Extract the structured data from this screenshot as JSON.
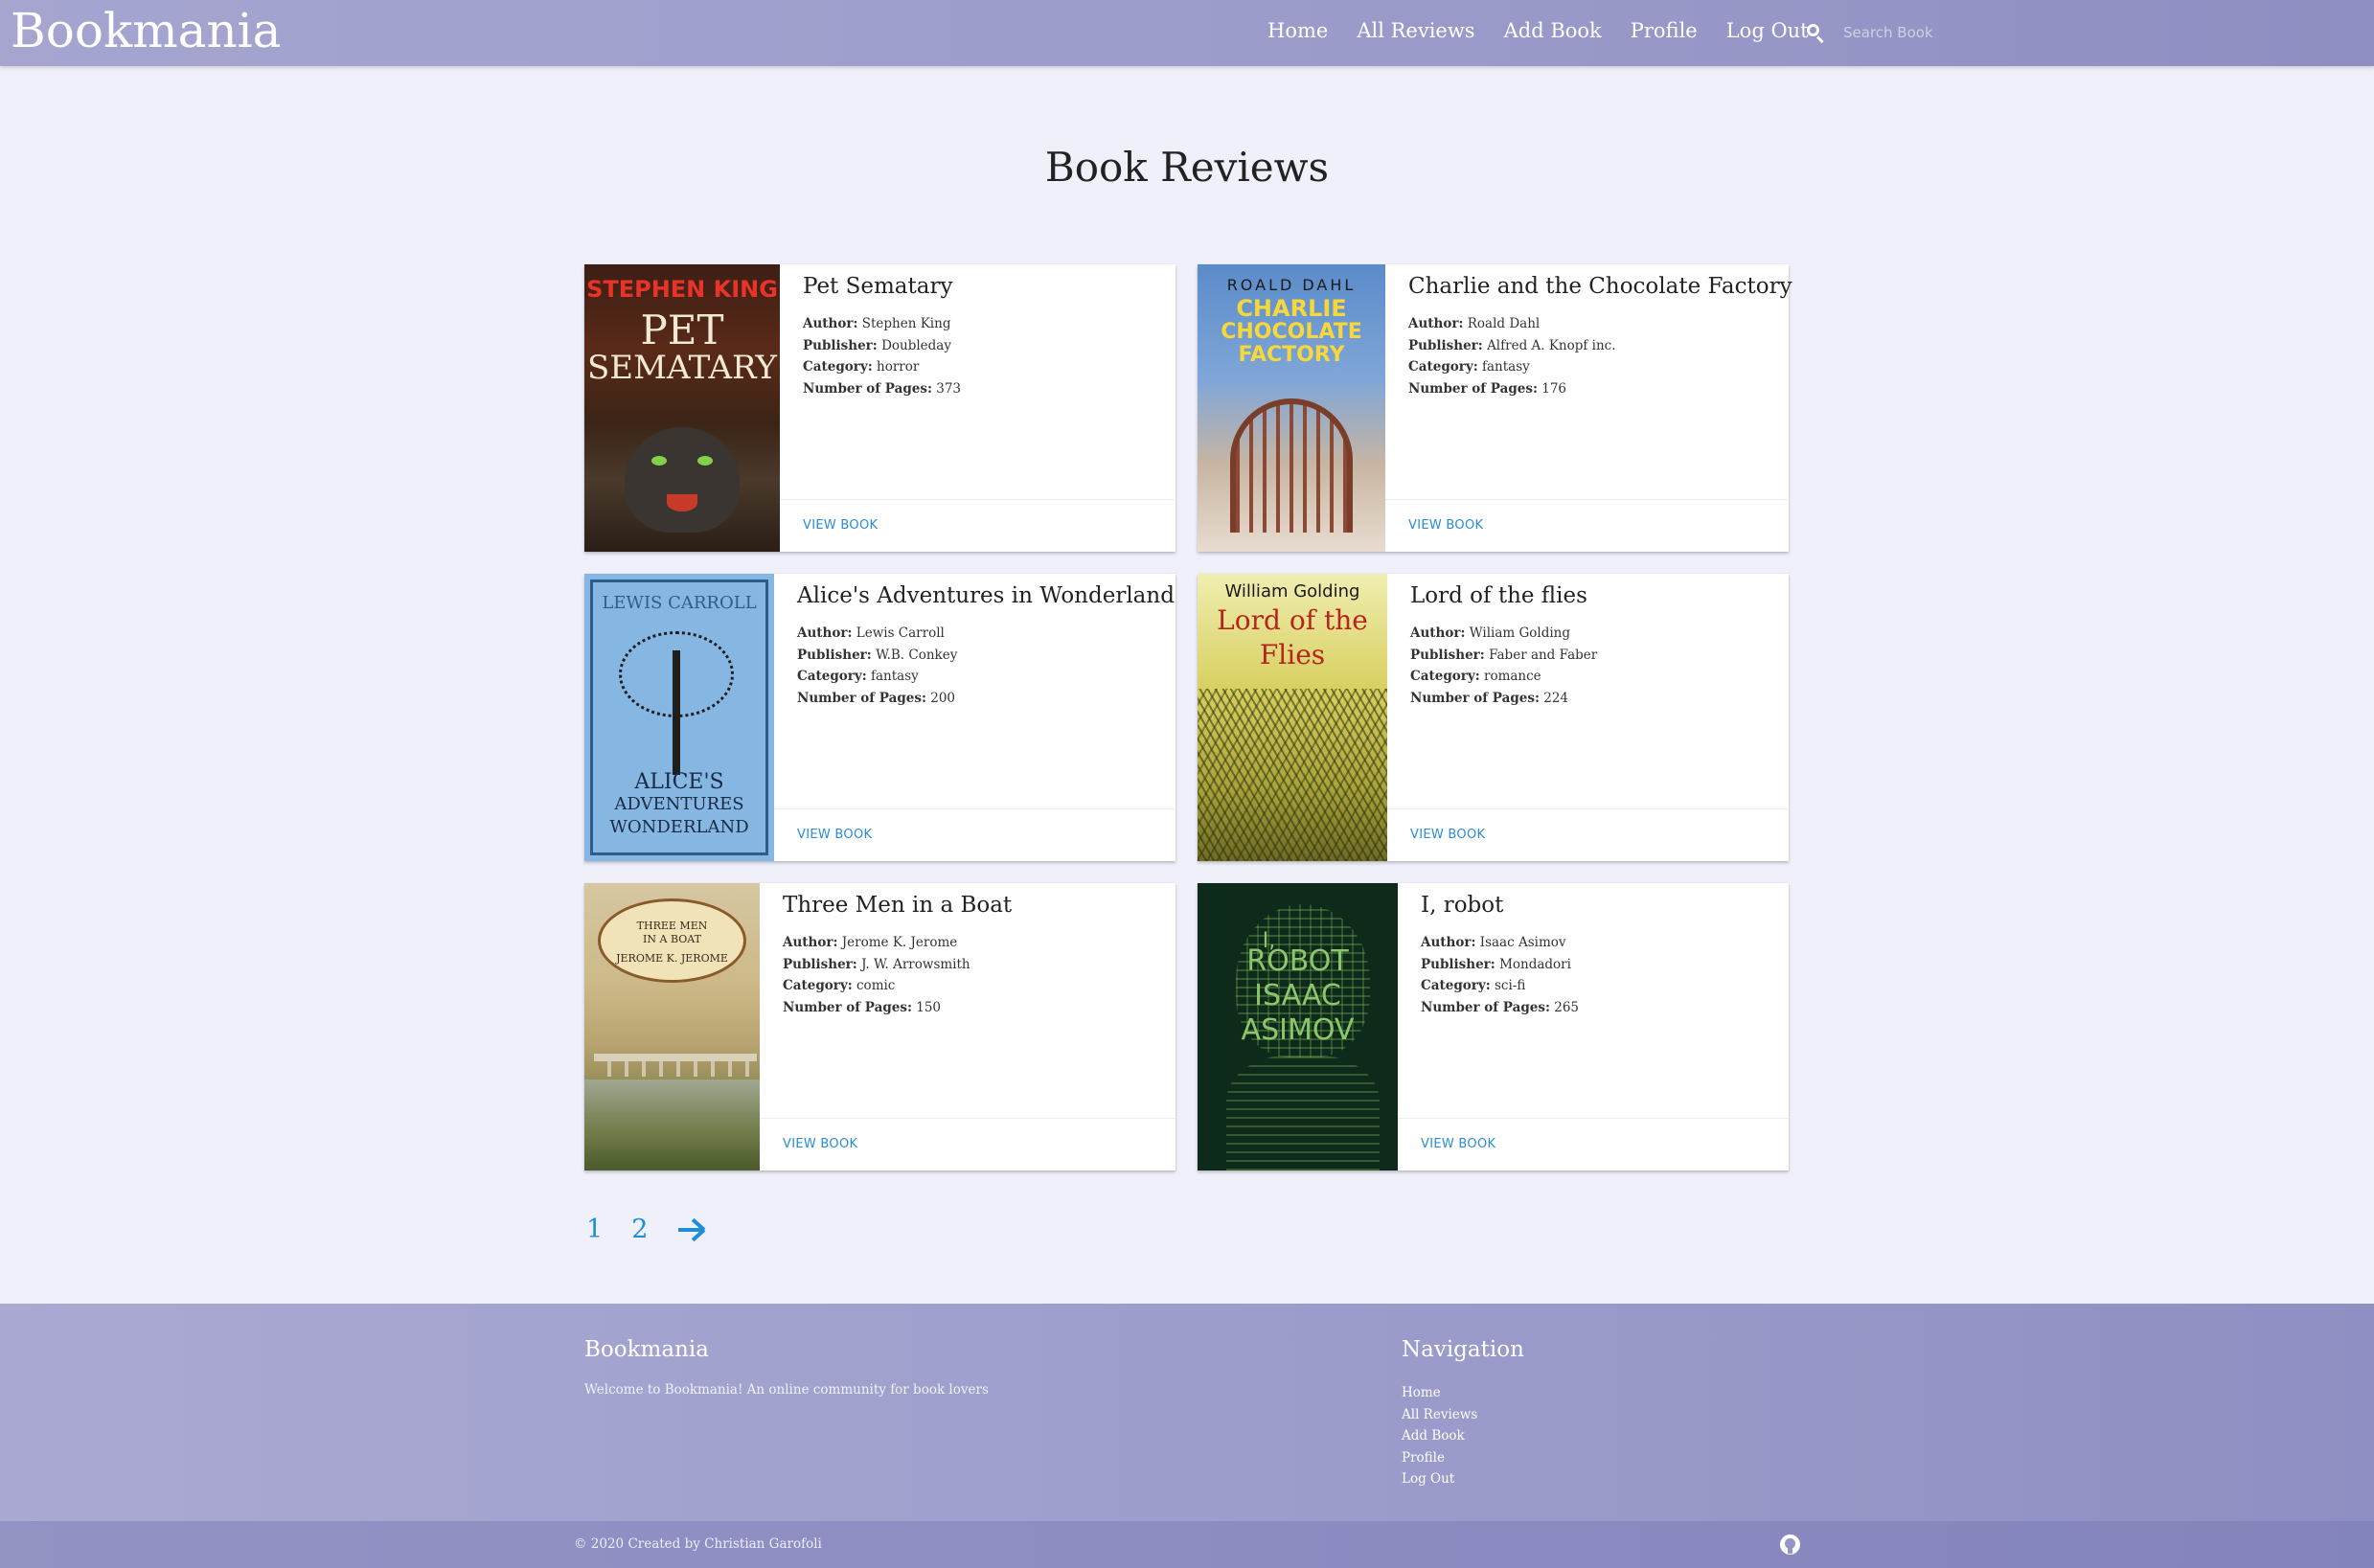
{
  "navbar": {
    "brand": "Bookmania",
    "links": [
      "Home",
      "All Reviews",
      "Add Book",
      "Profile",
      "Log Out"
    ],
    "search_placeholder": "Search Book"
  },
  "page_title": "Book Reviews",
  "labels": {
    "author": "Author:",
    "publisher": "Publisher:",
    "category": "Category:",
    "pages": "Number of Pages:",
    "view": "VIEW BOOK"
  },
  "books": [
    {
      "title": "Pet Sematary",
      "author": "Stephen King",
      "publisher": "Doubleday",
      "category": "horror",
      "pages": "373",
      "cover_lines": [
        "STEPHEN KING",
        "PET",
        "SEMATARY"
      ]
    },
    {
      "title": "Charlie and the Chocolate Factory",
      "author": "Roald Dahl",
      "publisher": "Alfred A. Knopf inc.",
      "category": "fantasy",
      "pages": "176",
      "cover_lines": [
        "ROALD DAHL",
        "CHARLIE",
        "CHOCOLATE",
        "FACTORY"
      ]
    },
    {
      "title": "Alice's Adventures in Wonderland",
      "author": "Lewis Carroll",
      "publisher": "W.B. Conkey",
      "category": "fantasy",
      "pages": "200",
      "cover_lines": [
        "LEWIS CARROLL",
        "ALICE'S",
        "ADVENTURES",
        "WONDERLAND"
      ]
    },
    {
      "title": "Lord of the flies",
      "author": "Wiliam Golding",
      "publisher": "Faber and Faber",
      "category": "romance",
      "pages": "224",
      "cover_lines": [
        "William Golding",
        "Lord of the",
        "Flies"
      ]
    },
    {
      "title": "Three Men in a Boat",
      "author": "Jerome K. Jerome",
      "publisher": "J. W. Arrowsmith",
      "category": "comic",
      "pages": "150",
      "cover_lines": [
        "THREE MEN",
        "IN A BOAT",
        "JEROME K. JEROME"
      ]
    },
    {
      "title": "I, robot",
      "author": "Isaac Asimov",
      "publisher": "Mondadori",
      "category": "sci-fi",
      "pages": "265",
      "cover_lines": [
        "I,",
        "ROBOT",
        "ISAAC",
        "ASIMOV"
      ]
    }
  ],
  "pagination": {
    "pages": [
      "1",
      "2"
    ]
  },
  "footer": {
    "title": "Bookmania",
    "tagline": "Welcome to Bookmania! An online community for book lovers",
    "nav_title": "Navigation",
    "nav_links": [
      "Home",
      "All Reviews",
      "Add Book",
      "Profile",
      "Log Out"
    ],
    "copyright": "© 2020 Created by Christian Garofoli"
  },
  "colors": {
    "accent": "#1e8fd6",
    "nav_bg": "#9d9dcc",
    "page_bg": "#f0f0fb"
  }
}
